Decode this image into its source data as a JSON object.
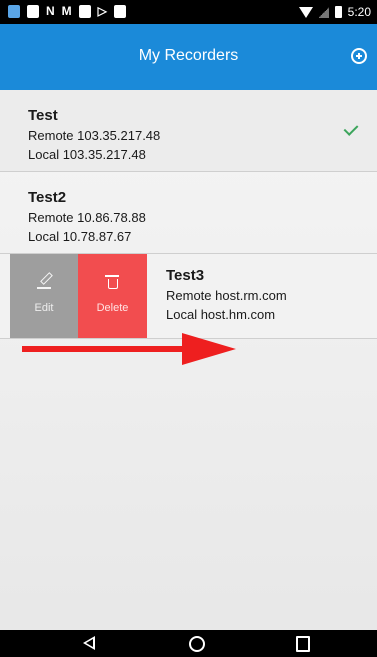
{
  "app": {
    "title": "My Recorders",
    "accent_color": "#1b8ad9",
    "add_icon": "plus-circle-icon"
  },
  "status_bar": {
    "time": "5:20"
  },
  "recorders": [
    {
      "name": "Test",
      "remote": "Remote 103.35.217.48",
      "local": "Local 103.35.217.48",
      "selected": true
    },
    {
      "name": "Test2",
      "remote": "Remote 10.86.78.88",
      "local": "Local 10.78.87.67",
      "selected": false
    },
    {
      "name": "Test3",
      "remote": "Remote host.rm.com",
      "local": "Local host.hm.com",
      "selected": false
    }
  ],
  "swipe_actions": {
    "edit_label": "Edit",
    "edit_icon": "pencil-icon",
    "edit_color": "#9e9e9e",
    "delete_label": "Delete",
    "delete_icon": "trash-icon",
    "delete_color": "#f24d4f"
  },
  "annotation": {
    "arrow_color": "#ee1f1f",
    "arrow_direction": "right"
  }
}
